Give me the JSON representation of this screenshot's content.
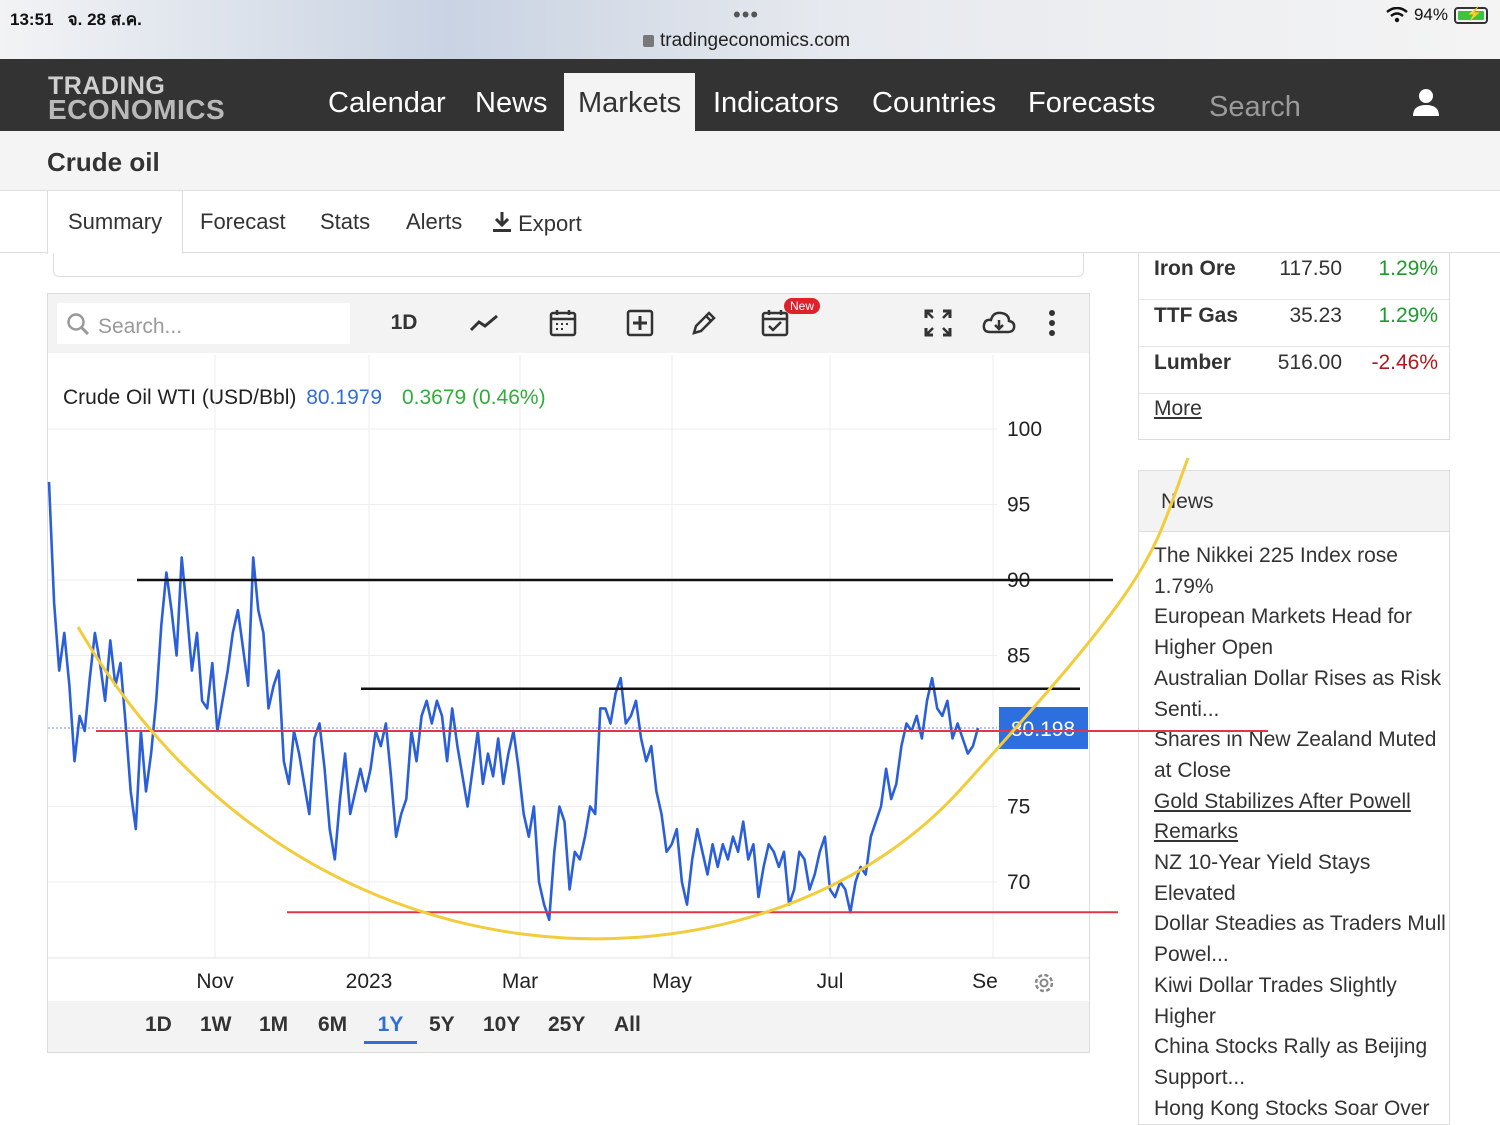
{
  "status": {
    "time": "13:51",
    "date": "จ. 28 ส.ค.",
    "dots": "•••",
    "url": "tradingeconomics.com",
    "battery": "94%"
  },
  "logo": {
    "line1": "TRADING",
    "line2": "ECONOMICS"
  },
  "nav": {
    "items": [
      "Calendar",
      "News",
      "Markets",
      "Indicators",
      "Countries",
      "Forecasts"
    ],
    "active": "Markets",
    "search_placeholder": "Search"
  },
  "page": {
    "title": "Crude oil"
  },
  "tabs": {
    "items": [
      "Summary",
      "Forecast",
      "Stats",
      "Alerts",
      "Export"
    ],
    "active": "Summary"
  },
  "toolbar": {
    "search_placeholder": "Search...",
    "interval": "1D",
    "new_badge": "New"
  },
  "legend": {
    "name": "Crude Oil WTI (USD/Bbl)",
    "price": "80.1979",
    "change": "0.3679 (0.46%)"
  },
  "ranges": {
    "items": [
      "1D",
      "1W",
      "1M",
      "6M",
      "1Y",
      "5Y",
      "10Y",
      "25Y",
      "All"
    ],
    "active": "1Y"
  },
  "chart_data": {
    "type": "line",
    "series": [
      {
        "name": "Crude Oil WTI (USD/Bbl)",
        "color": "#2b5fd9",
        "values": [
          96.5,
          88.5,
          84,
          86.5,
          83,
          78,
          81,
          80,
          83.5,
          86.5,
          84.5,
          82,
          86,
          83,
          84.5,
          80.5,
          76,
          73.5,
          80,
          76,
          78.5,
          82,
          87,
          90.5,
          88,
          85,
          91.5,
          88,
          84,
          86.5,
          82,
          81.5,
          84.5,
          80,
          82,
          84,
          86.5,
          88,
          85.5,
          83,
          91.5,
          88,
          86.5,
          81.5,
          83,
          84,
          78,
          76.5,
          80,
          78.5,
          76.5,
          74.5,
          79.5,
          80.5,
          77.5,
          73.5,
          71.5,
          75.5,
          78.5,
          74.5,
          76,
          77.5,
          76,
          77.5,
          80,
          79,
          80.5,
          77,
          73,
          74.5,
          75.5,
          80,
          78,
          81,
          82,
          80.5,
          82,
          81,
          78,
          81.5,
          79,
          77,
          75,
          77.5,
          80,
          76.5,
          78.5,
          77,
          79.5,
          76.5,
          78.5,
          80,
          77.5,
          74.5,
          73,
          75,
          70,
          68.5,
          67.5,
          72,
          75,
          74,
          69.5,
          72,
          71.5,
          73,
          75,
          74.5,
          81.5,
          81.5,
          80.5,
          82.5,
          83.5,
          80.5,
          81,
          82,
          79.5,
          78,
          79,
          76,
          74.5,
          72,
          72.5,
          73.5,
          70,
          68.5,
          71.5,
          73.5,
          72,
          70.5,
          72.5,
          71,
          72.5,
          71.5,
          73,
          72,
          74,
          71.5,
          72.5,
          69,
          71,
          72.5,
          72,
          71,
          72,
          68.5,
          69.5,
          72,
          71.5,
          69.5,
          70.5,
          72,
          73,
          69.5,
          69,
          70,
          69.5,
          68,
          70,
          71,
          70.5,
          73,
          74,
          75,
          77.5,
          75.5,
          76.5,
          79,
          80.5,
          80,
          81,
          79.5,
          82,
          83.5,
          81.5,
          81,
          82,
          79.5,
          80.5,
          79.5,
          78.5,
          79,
          80.2
        ]
      }
    ],
    "x_ticks": [
      "Nov",
      "2023",
      "Mar",
      "May",
      "Jul",
      "Se"
    ],
    "y_ticks": [
      70,
      75,
      85,
      90,
      95,
      100
    ],
    "ylim": [
      65.2,
      100.4
    ],
    "last_value_label": "80.198",
    "annotations": {
      "black_lines": [
        {
          "y": 90
        },
        {
          "y": 82.8
        }
      ],
      "red_lines": [
        {
          "y": 80
        },
        {
          "y": 68
        }
      ],
      "arc_color": "#f2cc3b"
    }
  },
  "movers": [
    {
      "name": "Iron Ore",
      "value": "117.50",
      "pct": "1.29%",
      "color": "#1e9a2c"
    },
    {
      "name": "TTF Gas",
      "value": "35.23",
      "pct": "1.29%",
      "color": "#1e9a2c"
    },
    {
      "name": "Lumber",
      "value": "516.00",
      "pct": "-2.46%",
      "color": "#b0161e"
    }
  ],
  "more_label": "More",
  "news": {
    "title": "News",
    "items": [
      "The Nikkei 225 Index rose 1.79%",
      "European Markets Head for Higher Open",
      "Australian Dollar Rises as Risk Senti...",
      "Shares in New Zealand Muted at Close",
      "Gold Stabilizes After Powell Remarks",
      "NZ 10-Year Yield Stays Elevated",
      "Dollar Steadies as Traders Mull Powel...",
      "Kiwi Dollar Trades Slightly Higher",
      "China Stocks Rally as Beijing Support...",
      "Hong Kong Stocks Soar Over"
    ]
  }
}
